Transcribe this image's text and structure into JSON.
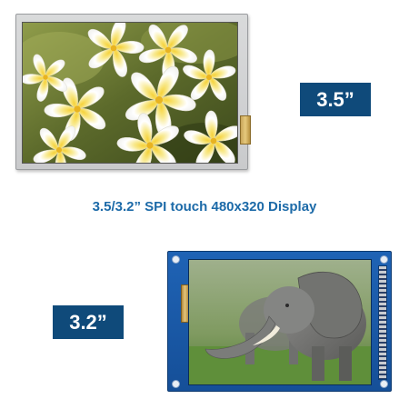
{
  "title": "3.5/3.2” SPI touch 480x320 Display",
  "badges": {
    "large": "3.5”",
    "small": "3.2”"
  },
  "colors": {
    "badge_bg": "#0f4a7a",
    "title_text": "#1c6aa8",
    "pcb_blue": "#1f63b5"
  },
  "images": {
    "top_screen": "frangipani-flowers",
    "bottom_screen": "elephant"
  }
}
